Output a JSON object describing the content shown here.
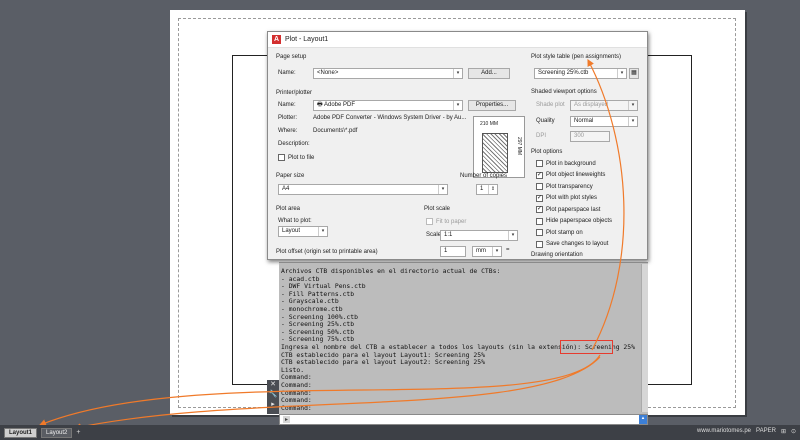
{
  "dialog": {
    "title": "Plot - Layout1",
    "page_setup": {
      "section": "Page setup",
      "name_label": "Name:",
      "name_value": "<None>",
      "add_button": "Add..."
    },
    "printer": {
      "section": "Printer/plotter",
      "name_label": "Name:",
      "name_value": "Adobe PDF",
      "properties_button": "Properties...",
      "plotter_label": "Plotter:",
      "plotter_value": "Adobe PDF Converter - Windows System Driver - by Au...",
      "where_label": "Where:",
      "where_value": "Documents\\*.pdf",
      "description_label": "Description:",
      "plot_to_file": "Plot to file",
      "dim_width": "210 MM",
      "dim_height": "297 MM"
    },
    "paper_size": {
      "section": "Paper size",
      "value": "A4"
    },
    "copies": {
      "label": "Number of copies",
      "value": "1"
    },
    "plot_area": {
      "section": "Plot area",
      "what_label": "What to plot:",
      "value": "Layout"
    },
    "plot_scale": {
      "section": "Plot scale",
      "fit_label": "Fit to paper",
      "scale_label": "Scale:",
      "scale_value": "1:1",
      "value": "1",
      "unit": "mm",
      "equals": "="
    },
    "plot_offset": {
      "label": "Plot offset (origin set to printable area)"
    },
    "plot_style_table": {
      "section": "Plot style table (pen assignments)",
      "value": "Screening 25%.ctb"
    },
    "shaded_viewport": {
      "section": "Shaded viewport options",
      "shade_label": "Shade plot",
      "shade_value": "As displayed",
      "quality_label": "Quality",
      "quality_value": "Normal",
      "dpi_label": "DPI",
      "dpi_value": "300"
    },
    "plot_options": {
      "section": "Plot options",
      "items": [
        {
          "label": "Plot in background",
          "checked": false
        },
        {
          "label": "Plot object lineweights",
          "checked": true
        },
        {
          "label": "Plot transparency",
          "checked": false
        },
        {
          "label": "Plot with plot styles",
          "checked": true
        },
        {
          "label": "Plot paperspace last",
          "checked": true
        },
        {
          "label": "Hide paperspace objects",
          "checked": false
        },
        {
          "label": "Plot stamp on",
          "checked": false
        },
        {
          "label": "Save changes to layout",
          "checked": false
        }
      ]
    },
    "drawing_orientation": {
      "section": "Drawing orientation"
    }
  },
  "command_window": {
    "lines": [
      "Archivos CTB disponibles en el directorio actual de CTBs:",
      "- acad.ctb",
      "- DWF Virtual Pens.ctb",
      "- Fill Patterns.ctb",
      "- Grayscale.ctb",
      "- monochrome.ctb",
      "- Screening 100%.ctb",
      "- Screening 25%.ctb",
      "- Screening 50%.ctb",
      "- Screening 75%.ctb",
      "Ingresa el nombre del CTB a establecer a todos los layouts (sin la extensión): Screening 25%",
      "CTB establecido para el layout Layout1: Screening 25%",
      "CTB establecido para el layout Layout2: Screening 25%",
      "Listo.",
      "Command:",
      "Command:",
      "Command:",
      "Command:",
      "Command:"
    ],
    "input_prefix": "▸"
  },
  "statusbar": {
    "tabs": [
      "Layout1",
      "Layout2"
    ],
    "add_tab": "+",
    "website": "www.mariotomes.pe",
    "paper": "PAPER"
  },
  "colors": {
    "arrow": "#f07a2a",
    "highlight": "#e63b2e",
    "accent": "#3c7fd6"
  }
}
